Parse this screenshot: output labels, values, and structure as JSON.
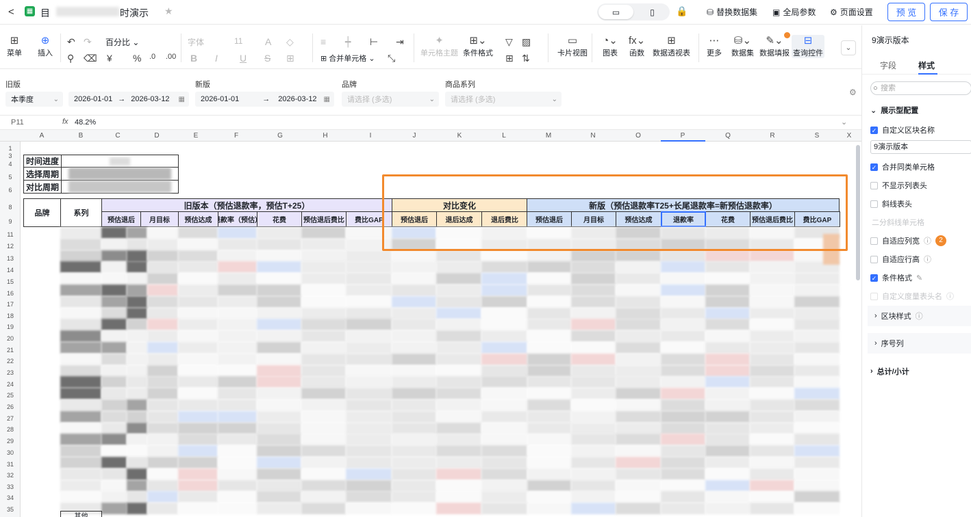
{
  "topbar": {
    "back": "<",
    "doc_title": "目",
    "doc_title_tail": "时演示",
    "replace_dataset": "替换数据集",
    "global_params": "全局参数",
    "page_settings": "页面设置",
    "preview": "预 览",
    "save": "保 存"
  },
  "toolbar": {
    "menu": "菜单",
    "insert": "插入",
    "percent_format": "百分比",
    "font": "字体",
    "font_size": "11",
    "merge_cells": "合并单元格",
    "cell_theme": "单元格主题",
    "cond_format": "条件格式",
    "card_view": "卡片视图",
    "chart": "图表",
    "function": "函数",
    "pivot": "数据透视表",
    "more": "更多",
    "dataset": "数据集",
    "data_fill": "数据填报",
    "query_ctrl": "查询控件"
  },
  "filters": {
    "old_label": "旧版",
    "old_period": "本季度",
    "old_start": "2026-01-01",
    "old_end": "2026-03-12",
    "new_label": "新版",
    "new_start": "2026-01-01",
    "new_end": "2026-03-12",
    "brand_label": "品牌",
    "brand_placeholder": "请选择 (多选)",
    "series_label": "商品系列",
    "series_placeholder": "请选择 (多选)"
  },
  "formula_bar": {
    "cell_ref": "P11",
    "fx": "fx",
    "value": "48.2%"
  },
  "columns": [
    "A",
    "B",
    "C",
    "D",
    "E",
    "F",
    "G",
    "H",
    "I",
    "J",
    "K",
    "L",
    "M",
    "N",
    "O",
    "P",
    "Q",
    "R",
    "S",
    "X"
  ],
  "rows": [
    "1",
    "3",
    "4",
    "5",
    "6",
    "8",
    "9",
    "11",
    "12",
    "13",
    "14",
    "15",
    "16",
    "17",
    "18",
    "19",
    "20",
    "21",
    "22",
    "23",
    "24",
    "25",
    "26",
    "27",
    "28",
    "29",
    "30",
    "31",
    "32",
    "33",
    "34",
    "35"
  ],
  "sheet": {
    "info_rows": [
      "时间进度",
      "选择周期",
      "对比周期"
    ],
    "brand": "品牌",
    "series": "系列",
    "group_old": "旧版本（预估退款率，预估T+25）",
    "group_change": "对比变化",
    "group_new": "新版（预估退款率T25+长尾退款率=新预估退款率）",
    "old_cols": [
      "预估退后",
      "月目标",
      "预估达成",
      "退款率（预估）",
      "花费",
      "预估退后费比",
      "费比GAP"
    ],
    "change_cols": [
      "预估退后",
      "退后达成",
      "退后费比"
    ],
    "new_cols": [
      "预估退后",
      "月目标",
      "预估达成",
      "退款率",
      "花费",
      "预估退后费比",
      "费比GAP"
    ],
    "other_label": "其他"
  },
  "sidebar": {
    "title": "9演示版本",
    "tab_fields": "字段",
    "tab_style": "样式",
    "search_placeholder": "搜索",
    "section_display": "展示型配置",
    "custom_block_name": "自定义区块名称",
    "block_name_value": "9演示版本",
    "merge_same_cells": "合并同类单元格",
    "hide_col_header": "不显示列表头",
    "diagonal_header": "斜线表头",
    "split_diagonal": "二分斜线单元格",
    "auto_col_width": "自适应列宽",
    "badge_num": "2",
    "auto_row_height": "自适应行高",
    "cond_format": "条件格式",
    "custom_measure_header": "自定义度量表头名",
    "block_style": "区块样式",
    "seq_col": "序号列",
    "total_subtotal": "总计/小计"
  },
  "colors": {
    "accent": "#3370ff",
    "highlight": "#f28a2e",
    "old_header": "#e8e4fb",
    "change_header": "#fde9c9",
    "new_header": "#cfdff7"
  }
}
